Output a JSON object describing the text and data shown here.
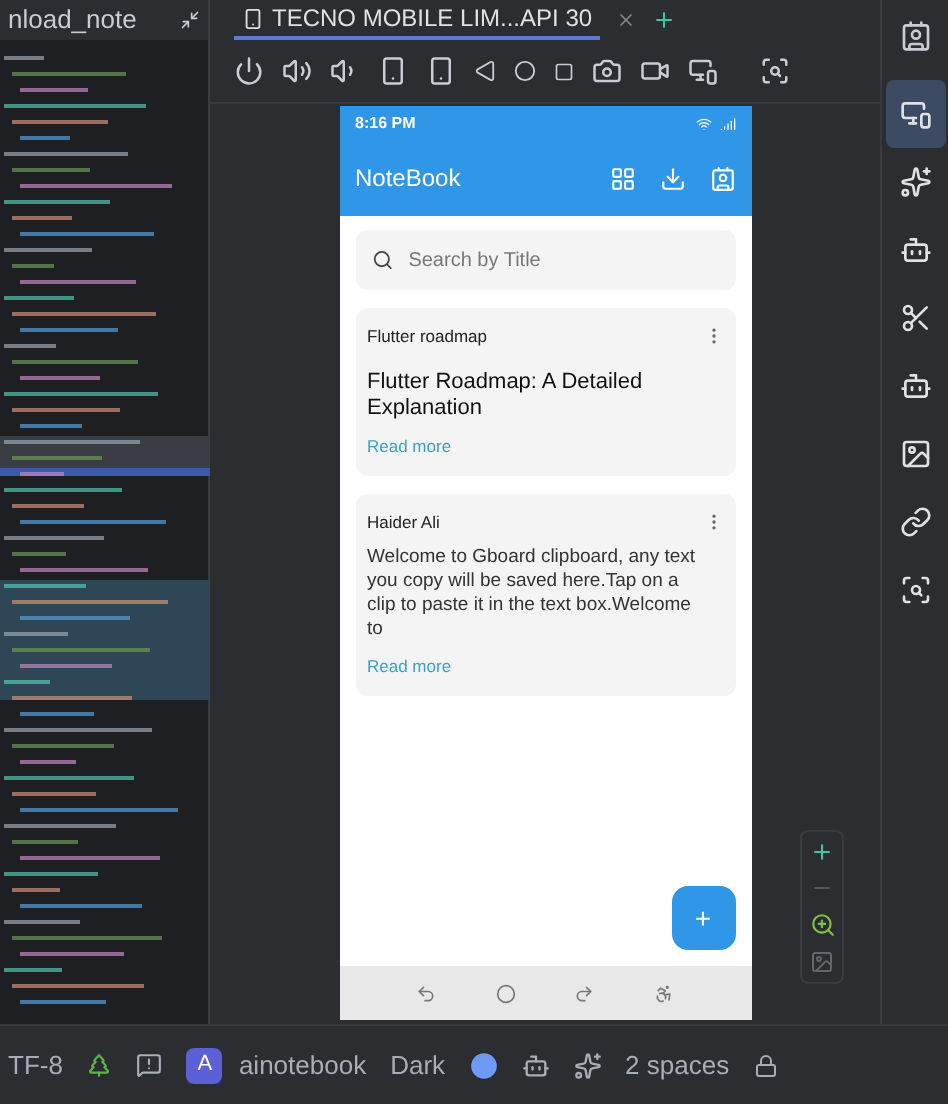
{
  "editor_tab": {
    "title": "nload_note"
  },
  "device_tab": {
    "title": "TECNO MOBILE LIM...API 30",
    "selected": true
  },
  "phone": {
    "status_time": "8:16 PM",
    "app_title": "NoteBook",
    "search": {
      "placeholder": "Search by Title"
    },
    "notes": [
      {
        "label": "Flutter roadmap",
        "title": "Flutter Roadmap: A Detailed Explanation",
        "link": "Read more"
      },
      {
        "label": "Haider Ali",
        "body": "Welcome to Gboard clipboard, any text you copy will be saved here.Tap on a clip to paste it in the text box.Welcome to",
        "link": "Read more"
      }
    ],
    "fab": "+"
  },
  "side_tools": [
    {
      "selected": true
    },
    {
      "selected": false
    },
    {
      "selected": false
    },
    {
      "selected": false
    },
    {
      "selected": false
    },
    {
      "selected": false
    },
    {
      "selected": false
    },
    {
      "selected": false
    }
  ],
  "status_bar": {
    "encoding": "TF-8",
    "project_badge": "A",
    "project": "ainotebook",
    "theme": "Dark",
    "indent": "2 spaces"
  }
}
